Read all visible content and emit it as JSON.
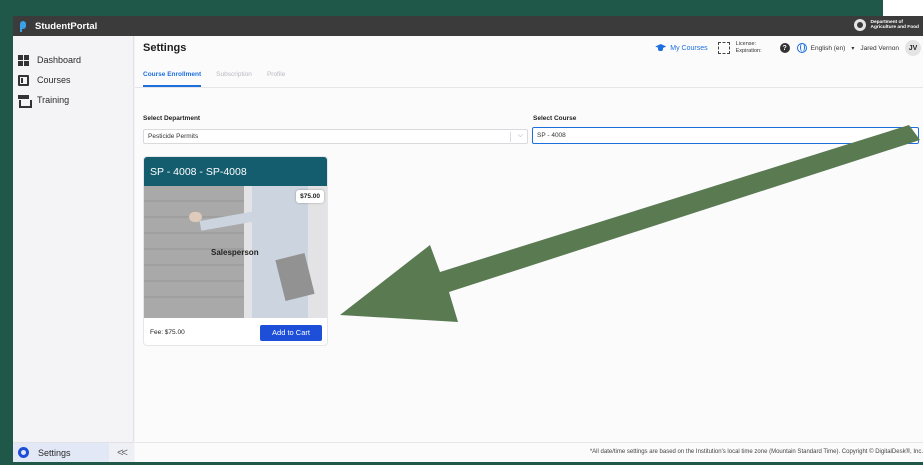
{
  "app": {
    "brand": "StudentPortal",
    "department_line1": "Department of",
    "department_line2": "Agriculture and Food"
  },
  "sidebar": {
    "items": [
      {
        "label": "Dashboard",
        "icon": "dashboard-icon"
      },
      {
        "label": "Courses",
        "icon": "courses-icon"
      },
      {
        "label": "Training",
        "icon": "training-icon"
      }
    ],
    "settings_label": "Settings",
    "collapse_glyph": "<<"
  },
  "header": {
    "title": "Settings",
    "my_courses": "My Courses",
    "license_label": "License:",
    "expiration_label": "Expiration:",
    "help_glyph": "?",
    "language": "English (en)",
    "caret": "▾",
    "user_name": "Jared Vernon",
    "user_initials": "JV"
  },
  "tabs": [
    {
      "label": "Course Enrollment",
      "active": true
    },
    {
      "label": "Subscription",
      "active": false
    },
    {
      "label": "Profile",
      "active": false
    }
  ],
  "form": {
    "department_label": "Select Department",
    "department_value": "Pesticide Permits",
    "course_label": "Select Course",
    "course_value": "SP - 4008",
    "chevron": "⌵"
  },
  "card": {
    "title": "SP - 4008 - SP-4008",
    "price_badge": "$75.00",
    "image_caption": "Salesperson",
    "fee": "Fee: $75.00",
    "button": "Add to Cart"
  },
  "footer": {
    "text": "*All date/time settings are based on the Institution's local time zone (Mountain Standard Time).   Copyright © DigitalDesk®, Inc."
  },
  "colors": {
    "outer_background": "#1f5848",
    "topbar": "#3b3b3b",
    "accent_blue": "#1d6fe0",
    "button_blue": "#1d4fd8",
    "card_header": "#145d6f",
    "annotation_arrow": "#5a7a52"
  }
}
